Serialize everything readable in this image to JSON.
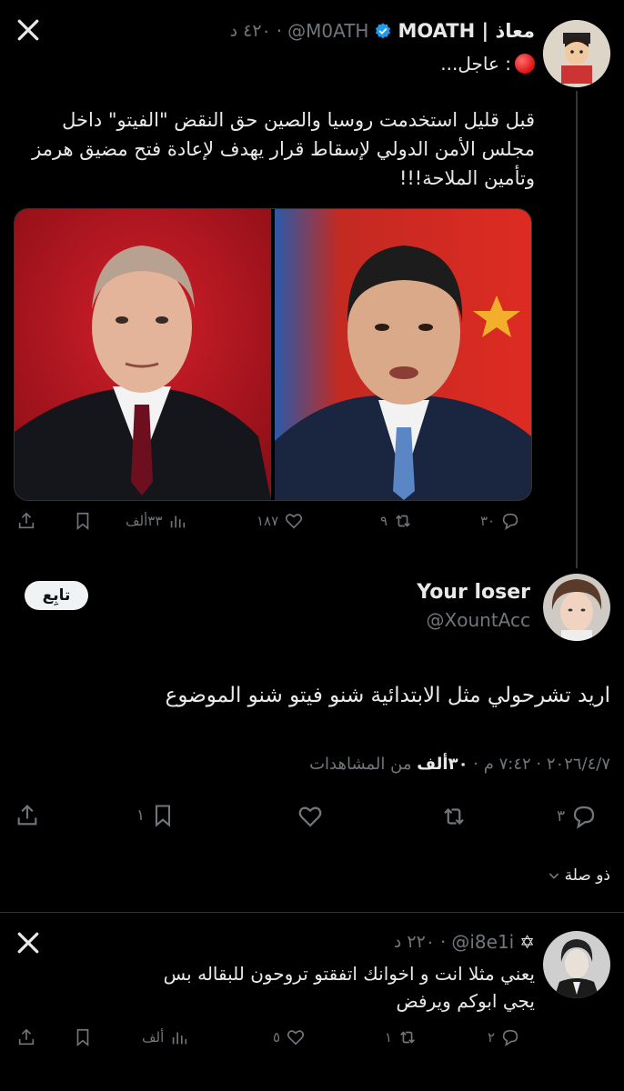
{
  "tweet1": {
    "name": "معاذ | MOATH",
    "handle": "@M0ATH",
    "time": "٤٢٠ د",
    "line1": ": عاجل...",
    "body": "قبل قليل استخدمت روسيا والصين حق النقض \"الفيتو\" داخل مجلس الأمن الدولي لإسقاط قرار يهدف لإعادة فتح مضيق هرمز وتأمين الملاحة!!!",
    "replies": "٣٠",
    "retweets": "٩",
    "likes": "١٨٧",
    "views": "٣٣ألف"
  },
  "reply": {
    "name": "Your loser",
    "handle": "@XountAcc",
    "follow_label": "تابِع",
    "text": "اريد تشرحولي مثل الابتدائية شنو فيتو شنو الموضوع",
    "meta_date": "٢٠٢٦/٤/٧ · ٧:٤٢ م ·",
    "meta_views_bold": "٣٠ألف",
    "meta_views_label": "من المشاهدات",
    "replies": "٣",
    "bookmarks": "١",
    "related_label": "ذو صلة"
  },
  "tweet3": {
    "name": "✡",
    "handle": "@i8e1i",
    "time": "٢٢٠ د",
    "text": "يعني مثلا انت و اخوانك اتفقتو تروحون للبقاله بس يجي ابوكم ويرفض",
    "replies": "٢",
    "retweets": "١",
    "likes": "٥",
    "views": "ألف"
  },
  "icons": [
    "x-logo-icon",
    "verified-badge-icon",
    "red-circle-icon",
    "reply-icon",
    "retweet-icon",
    "like-icon",
    "views-icon",
    "bookmark-icon",
    "share-icon",
    "chevron-down-icon"
  ],
  "colors": {
    "accent": "#1d9bf0",
    "muted": "#71767b",
    "bg": "#000000",
    "alert": "#e0245e"
  }
}
